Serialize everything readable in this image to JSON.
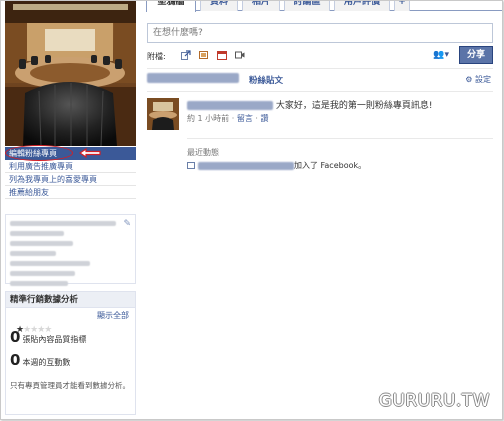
{
  "tabs": [
    "塗鴉牆",
    "資料",
    "相片",
    "討論區",
    "用戶評價",
    "+"
  ],
  "left_links": [
    "編輯粉絲專頁",
    "利用廣告推廣專頁",
    "列為我專頁上的喜愛專頁",
    "推薦給朋友"
  ],
  "composer": {
    "placeholder": "在想什麼嗎?",
    "attach_label": "附檔:",
    "share_label": "分享"
  },
  "feed": {
    "filter_label": "粉絲貼文",
    "settings_label": "設定",
    "post_text": "大家好，這是我的第一則粉絲專頁訊息!",
    "post_time": "約 1 小時前",
    "comment_label": "留言",
    "like_label": "讚",
    "recent_title": "最近動態",
    "recent_text": "加入了 Facebook。"
  },
  "insights": {
    "title": "精準行銷數據分析",
    "show_all": "顯示全部",
    "metric1_value": "0",
    "metric1_label": "張貼內容品質指標",
    "metric2_value": "0",
    "metric2_label": "本週的互動數",
    "note": "只有專頁管理員才能看到數據分析。"
  },
  "watermark": "GURURU.TW",
  "colors": {
    "fb_blue": "#3b5998",
    "highlight_red": "#d21f26",
    "share_button": "#5b74a8"
  }
}
